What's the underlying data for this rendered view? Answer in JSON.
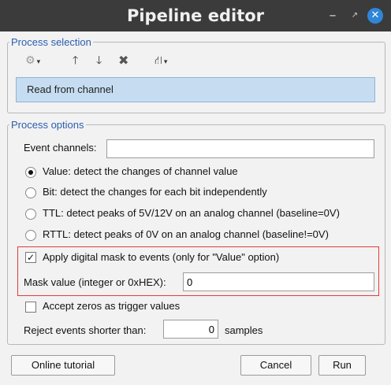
{
  "window": {
    "title": "Pipeline editor",
    "minimize": "–",
    "maximize": "↗",
    "close": "✕"
  },
  "process_selection": {
    "legend": "Process selection",
    "toolbar": {
      "gear": "⚙",
      "up": "🡑",
      "down": "🡓",
      "delete": "✖",
      "tree": "⛙",
      "caret": "▾"
    },
    "selected_process": "Read from channel"
  },
  "process_options": {
    "legend": "Process options",
    "event_channels_label": "Event channels:",
    "event_channels_value": "",
    "radios": [
      {
        "label": "Value: detect the changes of channel value",
        "checked": true
      },
      {
        "label": "Bit: detect the changes for each bit independently",
        "checked": false
      },
      {
        "label": "TTL: detect peaks of 5V/12V on an analog channel (baseline=0V)",
        "checked": false
      },
      {
        "label": "RTTL: detect peaks of 0V on an analog channel (baseline!=0V)",
        "checked": false
      }
    ],
    "apply_mask_label": "Apply digital mask to events (only for \"Value\" option)",
    "apply_mask_checked": true,
    "mask_value_label": "Mask value (integer or 0xHEX):",
    "mask_value": "0",
    "accept_zeros_label": "Accept zeros as trigger values",
    "accept_zeros_checked": false,
    "reject_label": "Reject events shorter than:",
    "reject_value": "0",
    "reject_unit": "samples"
  },
  "buttons": {
    "online_tutorial": "Online tutorial",
    "cancel": "Cancel",
    "run": "Run"
  }
}
